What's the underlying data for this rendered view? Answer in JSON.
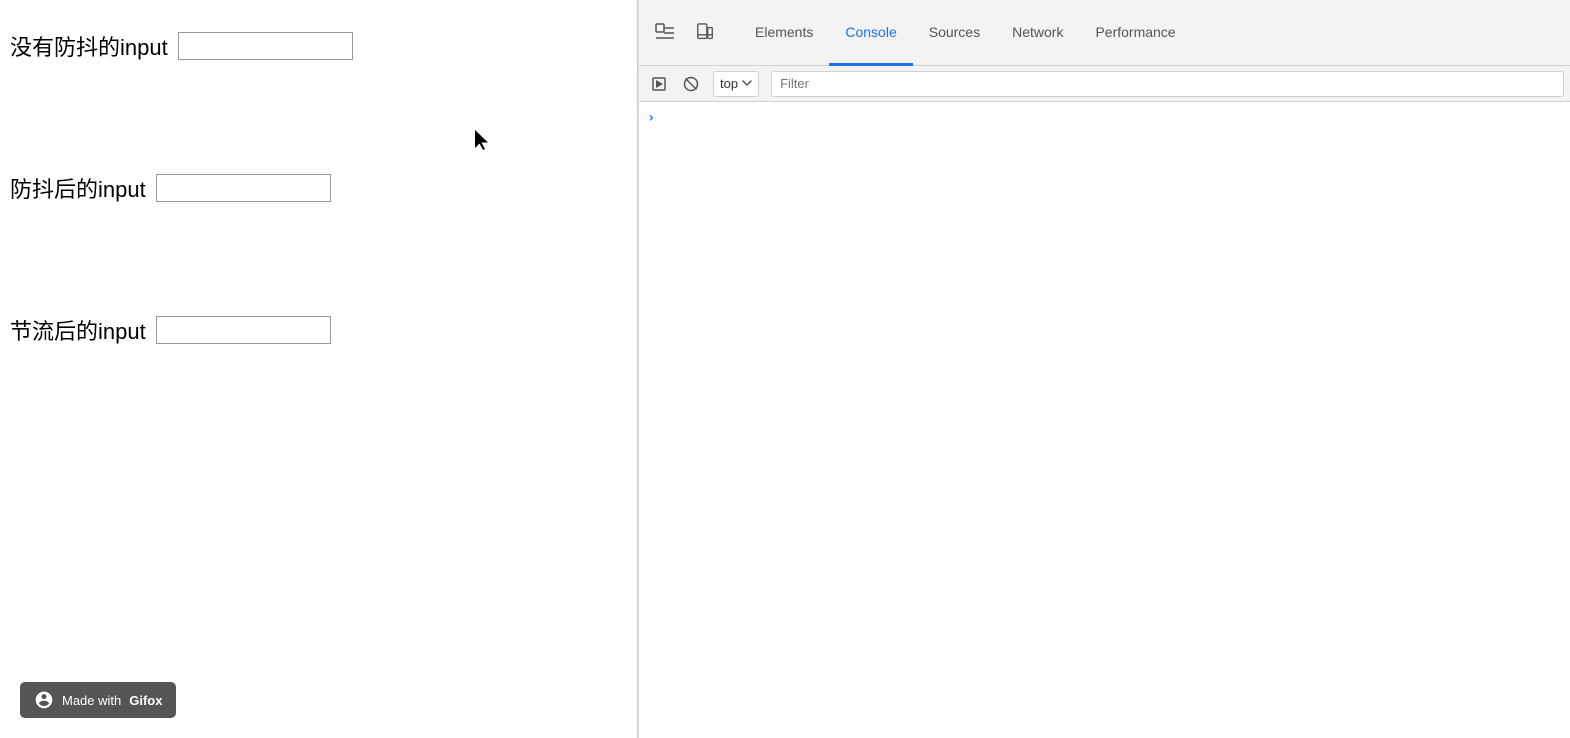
{
  "left_panel": {
    "inputs": [
      {
        "label": "没有防抖的input",
        "id": "no-debounce",
        "placeholder": "",
        "value": ""
      },
      {
        "label": "防抖后的input",
        "id": "debounced",
        "placeholder": "",
        "value": ""
      },
      {
        "label": "节流后的input",
        "id": "throttled",
        "placeholder": "",
        "value": ""
      }
    ],
    "badge": {
      "text": "Made with ",
      "brand": "Gifox"
    }
  },
  "devtools": {
    "tabs": [
      {
        "label": "Elements",
        "active": false
      },
      {
        "label": "Console",
        "active": true
      },
      {
        "label": "Sources",
        "active": false
      },
      {
        "label": "Network",
        "active": false
      },
      {
        "label": "Performance",
        "active": false
      }
    ],
    "console": {
      "top_selector": "top",
      "filter_placeholder": "Filter"
    }
  }
}
